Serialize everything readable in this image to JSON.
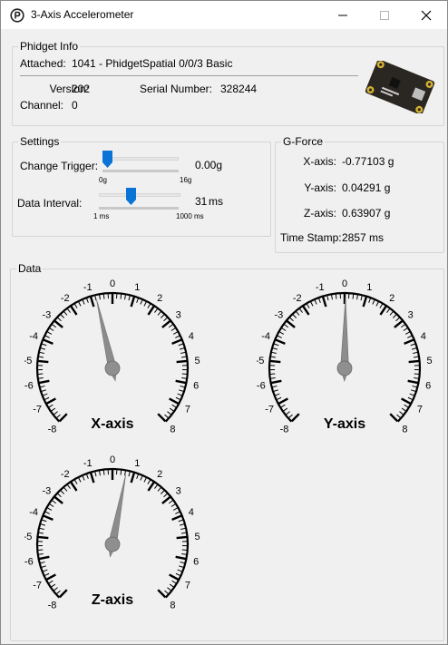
{
  "window": {
    "title": "3-Axis Accelerometer"
  },
  "phidget_info": {
    "legend": "Phidget Info",
    "attached_label": "Attached:",
    "attached_value": "1041 - PhidgetSpatial 0/0/3 Basic",
    "version_label": "Version:",
    "version_value": "202",
    "serial_label": "Serial Number:",
    "serial_value": "328244",
    "channel_label": "Channel:",
    "channel_value": "0"
  },
  "settings": {
    "legend": "Settings",
    "change_trigger_label": "Change Trigger:",
    "change_trigger_value": "0.00g",
    "change_trigger_min": "0g",
    "change_trigger_max": "16g",
    "change_trigger_fraction": 0.0,
    "data_interval_label": "Data Interval:",
    "data_interval_value": "31",
    "data_interval_unit": "ms",
    "data_interval_min": "1 ms",
    "data_interval_max": "1000 ms",
    "data_interval_fraction": 0.4
  },
  "gforce": {
    "legend": "G-Force",
    "x_label": "X-axis:",
    "x_value": "-0.77103 g",
    "y_label": "Y-axis:",
    "y_value": "0.04291 g",
    "z_label": "Z-axis:",
    "z_value": "0.63907 g",
    "timestamp_label": "Time Stamp:",
    "timestamp_value": "2857 ms"
  },
  "data": {
    "legend": "Data",
    "scale_min": -8,
    "scale_max": 8,
    "gauges": [
      {
        "label": "X-axis",
        "value": -0.77103
      },
      {
        "label": "Y-axis",
        "value": 0.04291
      },
      {
        "label": "Z-axis",
        "value": 0.63907
      }
    ]
  },
  "colors": {
    "slider_thumb": "#0a74d6",
    "title_bg": "#ffffff",
    "window_bg": "#f0f0f0",
    "needle": "#8c8c8c"
  },
  "icons": {
    "app": "phidgets-logo-icon",
    "minimize": "minimize-icon",
    "maximize": "maximize-icon",
    "close": "close-icon"
  }
}
